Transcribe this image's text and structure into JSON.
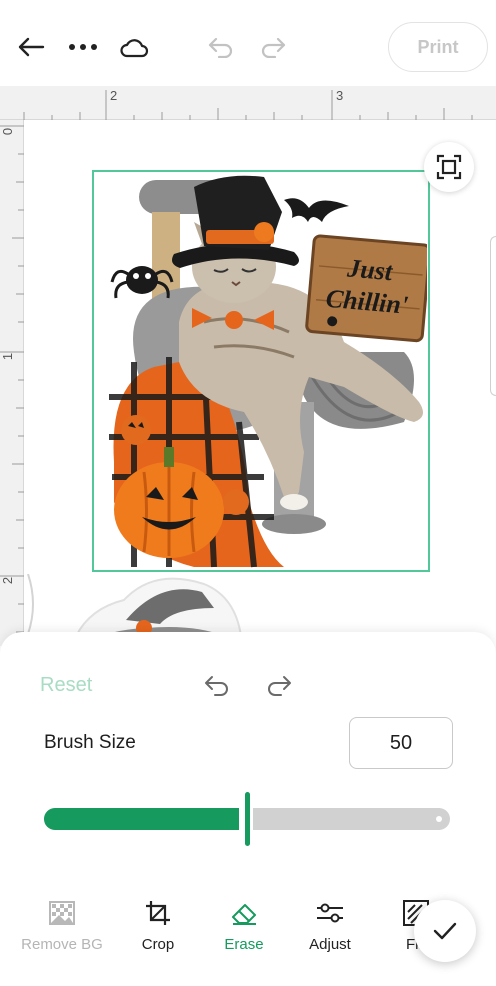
{
  "toolbar": {
    "back_icon": "arrow-left-icon",
    "more_icon": "more-dots-icon",
    "cloud_icon": "cloud-icon",
    "undo_icon": "undo-icon",
    "redo_icon": "redo-icon",
    "print_label": "Print"
  },
  "ruler": {
    "horizontal": [
      "2",
      "3"
    ],
    "vertical": [
      "0",
      "1",
      "2"
    ]
  },
  "canvas": {
    "focus_icon": "fit-to-screen-icon",
    "selection_color": "#52c79a",
    "artwork": {
      "sign_line1": "Just",
      "sign_line2": "Chillin'"
    }
  },
  "panel": {
    "reset_label": "Reset",
    "brush_size_label": "Brush Size",
    "brush_size_value": "50",
    "brush_size_fraction": 0.5,
    "accent_color": "#169a5e",
    "track_color": "#d1d1d1"
  },
  "tools": [
    {
      "label": "Remove BG",
      "icon": "checker-image-icon",
      "state": "disabled"
    },
    {
      "label": "Crop",
      "icon": "crop-icon",
      "state": "default"
    },
    {
      "label": "Erase",
      "icon": "eraser-icon",
      "state": "active"
    },
    {
      "label": "Adjust",
      "icon": "sliders-icon",
      "state": "default"
    },
    {
      "label": "Filt",
      "icon": "filter-icon",
      "state": "default"
    }
  ],
  "confirm_icon": "checkmark-icon"
}
